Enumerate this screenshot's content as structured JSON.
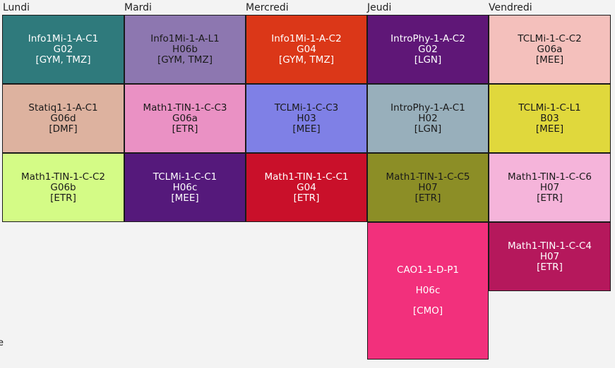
{
  "days": [
    "Lundi",
    "Mardi",
    "Mercredi",
    "Jeudi",
    "Vendredi"
  ],
  "edge_text": "e",
  "courses": {
    "lun1": {
      "name": "Info1Mi-1-A-C1",
      "room": "G02",
      "teachers": "[GYM, TMZ]",
      "bg": "#2f7a7c",
      "fg": "#ffffff"
    },
    "mar1": {
      "name": "Info1Mi-1-A-L1",
      "room": "H06b",
      "teachers": "[GYM, TMZ]",
      "bg": "#8d77b0",
      "fg": "#1a1a1a"
    },
    "mer1": {
      "name": "Info1Mi-1-A-C2",
      "room": "G04",
      "teachers": "[GYM, TMZ]",
      "bg": "#db3718",
      "fg": "#ffffff"
    },
    "jeu1": {
      "name": "IntroPhy-1-A-C2",
      "room": "G02",
      "teachers": "[LGN]",
      "bg": "#5f1777",
      "fg": "#ffffff"
    },
    "ven1": {
      "name": "TCLMi-1-C-C2",
      "room": "G06a",
      "teachers": "[MEE]",
      "bg": "#f4c0bc",
      "fg": "#1a1a1a"
    },
    "lun2": {
      "name": "Statiq1-1-A-C1",
      "room": "G06d",
      "teachers": "[DMF]",
      "bg": "#ddb29f",
      "fg": "#1a1a1a"
    },
    "mar2": {
      "name": "Math1-TIN-1-C-C3",
      "room": "G06a",
      "teachers": "[ETR]",
      "bg": "#ea91c4",
      "fg": "#1a1a1a"
    },
    "mer2": {
      "name": "TCLMi-1-C-C3",
      "room": "H03",
      "teachers": "[MEE]",
      "bg": "#7f80e6",
      "fg": "#1a1a1a"
    },
    "jeu2": {
      "name": "IntroPhy-1-A-C1",
      "room": "H02",
      "teachers": "[LGN]",
      "bg": "#98afbb",
      "fg": "#1a1a1a"
    },
    "ven2": {
      "name": "TCLMi-1-C-L1",
      "room": "B03",
      "teachers": "[MEE]",
      "bg": "#e0d83c",
      "fg": "#1a1a1a"
    },
    "lun3": {
      "name": "Math1-TIN-1-C-C2",
      "room": "G06b",
      "teachers": "[ETR]",
      "bg": "#d4fb86",
      "fg": "#1a1a1a"
    },
    "mar3": {
      "name": "TCLMi-1-C-C1",
      "room": "H06c",
      "teachers": "[MEE]",
      "bg": "#55197b",
      "fg": "#ffffff"
    },
    "mer3": {
      "name": "Math1-TIN-1-C-C1",
      "room": "G04",
      "teachers": "[ETR]",
      "bg": "#c9102a",
      "fg": "#ffffff"
    },
    "jeu3": {
      "name": "Math1-TIN-1-C-C5",
      "room": "H07",
      "teachers": "[ETR]",
      "bg": "#8c8e26",
      "fg": "#1a1a1a"
    },
    "ven3": {
      "name": "Math1-TIN-1-C-C6",
      "room": "H07",
      "teachers": "[ETR]",
      "bg": "#f5b4da",
      "fg": "#1a1a1a"
    },
    "jeu4": {
      "name": "CAO1-1-D-P1",
      "room": "H06c",
      "teachers": "[CMO]",
      "bg": "#f2307c",
      "fg": "#ffffff"
    },
    "ven4": {
      "name": "Math1-TIN-1-C-C4",
      "room": "H07",
      "teachers": "[ETR]",
      "bg": "#b5185c",
      "fg": "#ffffff"
    }
  }
}
